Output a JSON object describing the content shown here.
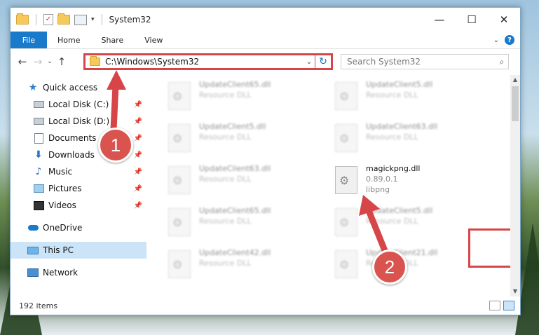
{
  "window": {
    "title": "System32",
    "controls": {
      "minimize": "—",
      "maximize": "☐",
      "close": "✕"
    }
  },
  "ribbon": {
    "file_tab": "File",
    "tabs": [
      "Home",
      "Share",
      "View"
    ],
    "help": "?"
  },
  "address_bar": {
    "path": "C:\\Windows\\System32",
    "dropdown": "⌄",
    "refresh": "↻"
  },
  "search": {
    "placeholder": "Search System32",
    "icon": "search-icon"
  },
  "nav_pane": {
    "items": [
      {
        "label": "Quick access",
        "icon": "star-icon",
        "pinned": false
      },
      {
        "label": "Local Disk (C:)",
        "icon": "drive-icon",
        "pinned": true
      },
      {
        "label": "Local Disk (D:)",
        "icon": "drive-icon",
        "pinned": true
      },
      {
        "label": "Documents",
        "icon": "documents-icon",
        "pinned": true
      },
      {
        "label": "Downloads",
        "icon": "download-icon",
        "pinned": true
      },
      {
        "label": "Music",
        "icon": "music-icon",
        "pinned": true
      },
      {
        "label": "Pictures",
        "icon": "pictures-icon",
        "pinned": true
      },
      {
        "label": "Videos",
        "icon": "videos-icon",
        "pinned": true
      },
      {
        "label": "OneDrive",
        "icon": "cloud-icon",
        "pinned": false
      },
      {
        "label": "This PC",
        "icon": "pc-icon",
        "pinned": false,
        "selected": true
      },
      {
        "label": "Network",
        "icon": "network-icon",
        "pinned": false
      }
    ]
  },
  "files": [
    {
      "name": "UpdateClient65.dll",
      "desc": "Resource DLL"
    },
    {
      "name": "UpdateClient5.dll",
      "desc": "Resource DLL"
    },
    {
      "name": "UpdateClient5.dll",
      "desc": "Resource DLL"
    },
    {
      "name": "UpdateClient63.dll",
      "desc": "Resource DLL"
    },
    {
      "name": "UpdateClient63.dll",
      "desc": "Resource DLL"
    },
    {
      "name": "UpdateClient65.dll",
      "desc": "Resource DLL"
    },
    {
      "name": "UpdateClient5.dll",
      "desc": "Resource DLL"
    },
    {
      "name": "UpdateClient42.dll",
      "desc": "Resource DLL"
    },
    {
      "name": "UpdateClient21.dll",
      "desc": "Resource DLL"
    }
  ],
  "highlighted_file": {
    "name": "magickpng.dll",
    "version": "0.89.0.1",
    "company": "libpng"
  },
  "status_bar": {
    "count": "192 items"
  },
  "annotations": {
    "step1": "1",
    "step2": "2",
    "color": "#d64548"
  }
}
